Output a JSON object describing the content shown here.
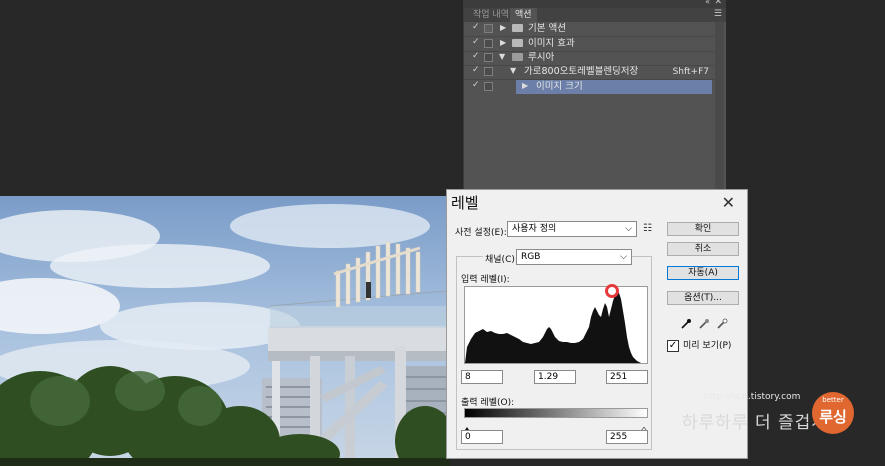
{
  "actions_panel": {
    "tabs": [
      "작업 내역",
      "액션"
    ],
    "active_tab": "액션",
    "rows": [
      {
        "label": "기본 액션",
        "type": "set",
        "expanded": false
      },
      {
        "label": "이미지 효과",
        "type": "set",
        "expanded": false
      },
      {
        "label": "루시아",
        "type": "set",
        "expanded": true
      },
      {
        "label": "가로800오토레벨블렌딩저장",
        "type": "action",
        "shortcut": "Shft+F7",
        "expanded": true
      },
      {
        "label": "이미지 크기",
        "type": "step",
        "selected": true
      }
    ]
  },
  "levels_dialog": {
    "title": "레벨",
    "preset_label": "사전 설정(E):",
    "preset_value": "사용자 정의",
    "channel_label": "채널(C):",
    "channel_value": "RGB",
    "input_levels_label": "입력 레벨(I):",
    "input_black": "8",
    "input_gamma": "1.29",
    "input_white": "251",
    "output_levels_label": "출력 레벨(O):",
    "output_black": "0",
    "output_white": "255",
    "buttons": {
      "ok": "확인",
      "cancel": "취소",
      "auto": "자동(A)",
      "options": "옵션(T)..."
    },
    "preview_label": "미리 보기(P)",
    "preview_checked": true
  },
  "watermark": {
    "url": "http://ucn.tistory.com",
    "tagline": "하루하루 더 즐겁게",
    "logo_top": "better",
    "logo_main": "루싱"
  },
  "colors": {
    "panel_bg": "#535353",
    "selected_row": "#6b7fa8",
    "default_button_border": "#0078d7",
    "logo": "#e0672f"
  }
}
